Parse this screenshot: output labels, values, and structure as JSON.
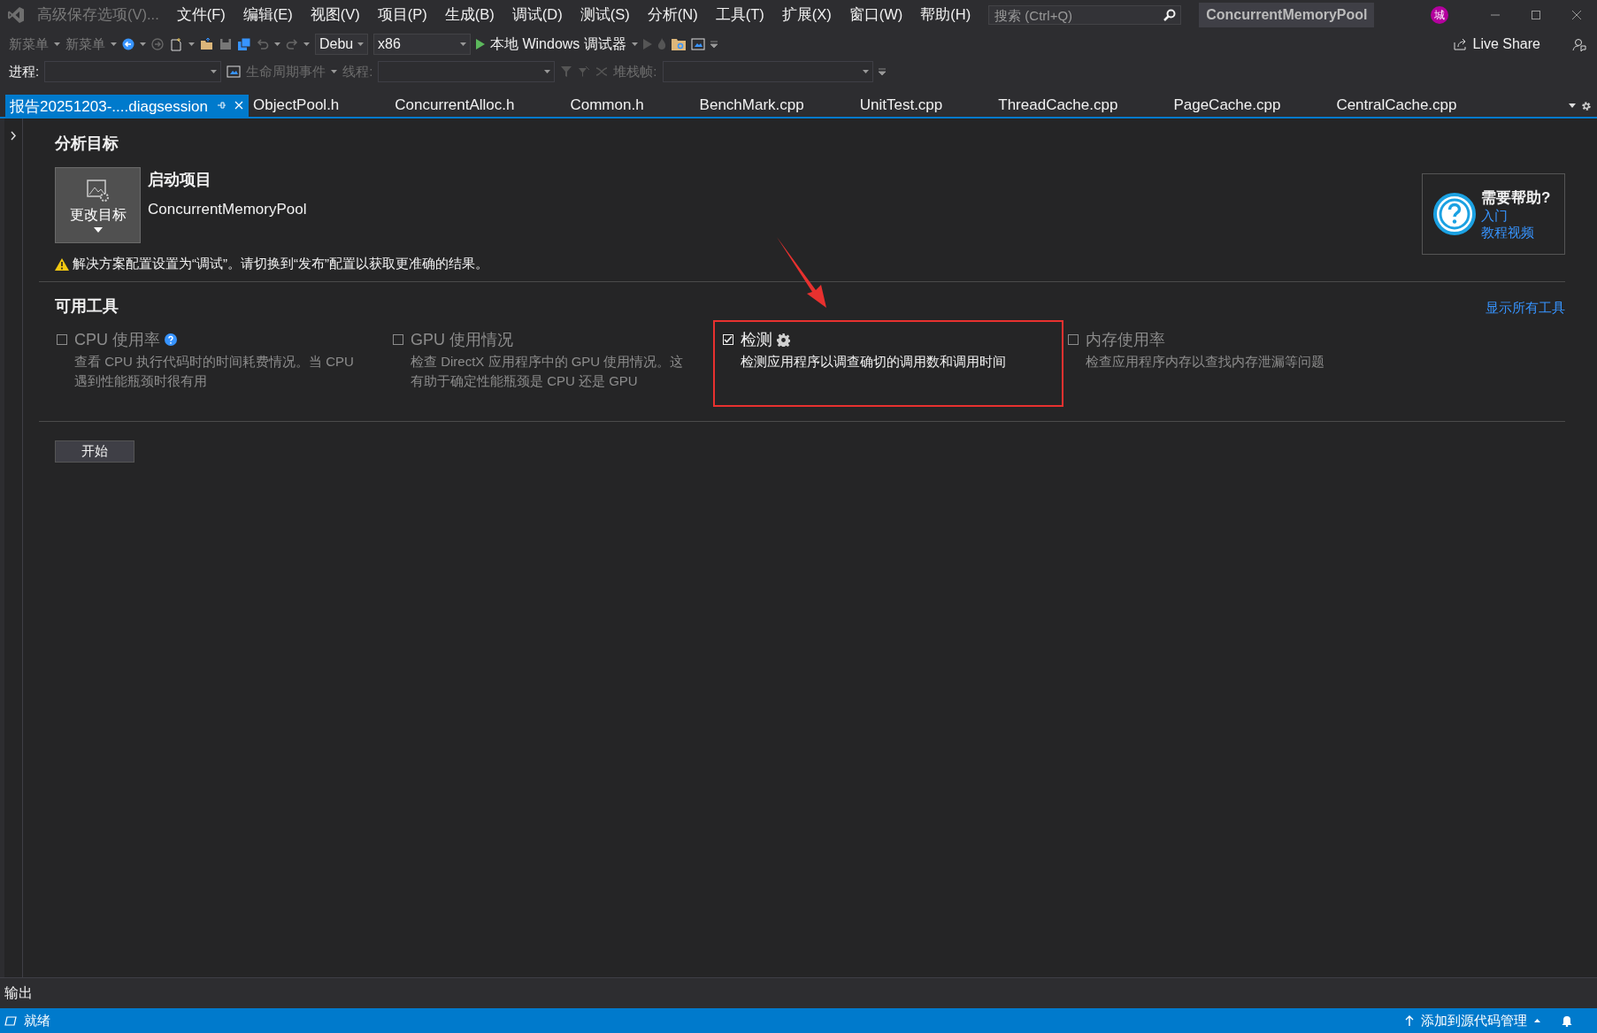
{
  "title_bar": {
    "menus": [
      {
        "label": "高级保存选项(V)...",
        "disabled": true
      },
      {
        "label": "文件(F)",
        "disabled": false
      },
      {
        "label": "编辑(E)",
        "disabled": false
      },
      {
        "label": "视图(V)",
        "disabled": false
      },
      {
        "label": "项目(P)",
        "disabled": false
      },
      {
        "label": "生成(B)",
        "disabled": false
      },
      {
        "label": "调试(D)",
        "disabled": false
      },
      {
        "label": "测试(S)",
        "disabled": false
      },
      {
        "label": "分析(N)",
        "disabled": false
      },
      {
        "label": "工具(T)",
        "disabled": false
      },
      {
        "label": "扩展(X)",
        "disabled": false
      },
      {
        "label": "窗口(W)",
        "disabled": false
      },
      {
        "label": "帮助(H)",
        "disabled": false
      }
    ],
    "search": {
      "placeholder": "搜索 (Ctrl+Q)"
    },
    "solution": "ConcurrentMemoryPool",
    "avatar": "城"
  },
  "toolbar": {
    "menus": [
      "新菜单",
      "新菜单"
    ],
    "configuration": "Debu",
    "platform": "x86",
    "run": "本地 Windows 调试器",
    "live_share": "Live Share"
  },
  "debug_bar": {
    "process_label": "进程:",
    "lifecycle": "生命周期事件",
    "thread_label": "线程:",
    "stack_label": "堆栈帧:"
  },
  "tabs": [
    {
      "label": "报告20251203-....diagsession",
      "selected": true
    },
    {
      "label": "ObjectPool.h",
      "selected": false
    },
    {
      "label": "ConcurrentAlloc.h",
      "selected": false
    },
    {
      "label": "Common.h",
      "selected": false
    },
    {
      "label": "BenchMark.cpp",
      "selected": false
    },
    {
      "label": "UnitTest.cpp",
      "selected": false
    },
    {
      "label": "ThreadCache.cpp",
      "selected": false
    },
    {
      "label": "PageCache.cpp",
      "selected": false
    },
    {
      "label": "CentralCache.cpp",
      "selected": false
    }
  ],
  "target": {
    "heading": "分析目标",
    "change_button": "更改目标",
    "startup_label": "启动项目",
    "project": "ConcurrentMemoryPool",
    "warning": "解决方案配置设置为“调试”。请切换到“发布”配置以获取更准确的结果。"
  },
  "help": {
    "title": "需要帮助?",
    "links": [
      "入门",
      "教程视频"
    ]
  },
  "tools": {
    "heading": "可用工具",
    "show_all": "显示所有工具",
    "items": [
      {
        "name": "CPU 使用率",
        "checked": false,
        "help_icon": true,
        "settings_icon": false,
        "highlighted": false,
        "description": "查看 CPU 执行代码时的时间耗费情况。当 CPU 遇到性能瓶颈时很有用"
      },
      {
        "name": "GPU 使用情况",
        "checked": false,
        "help_icon": false,
        "settings_icon": false,
        "highlighted": false,
        "description": "检查 DirectX 应用程序中的 GPU 使用情况。这有助于确定性能瓶颈是 CPU 还是 GPU"
      },
      {
        "name": "检测",
        "checked": true,
        "help_icon": false,
        "settings_icon": true,
        "highlighted": true,
        "description": "检测应用程序以调查确切的调用数和调用时间"
      },
      {
        "name": "内存使用率",
        "checked": false,
        "help_icon": false,
        "settings_icon": false,
        "highlighted": false,
        "description": "检查应用程序内存以查找内存泄漏等问题"
      }
    ]
  },
  "start_button": "开始",
  "output_panel": {
    "title": "输出"
  },
  "status_bar": {
    "text": "就绪",
    "source_control": "添加到源代码管理"
  }
}
